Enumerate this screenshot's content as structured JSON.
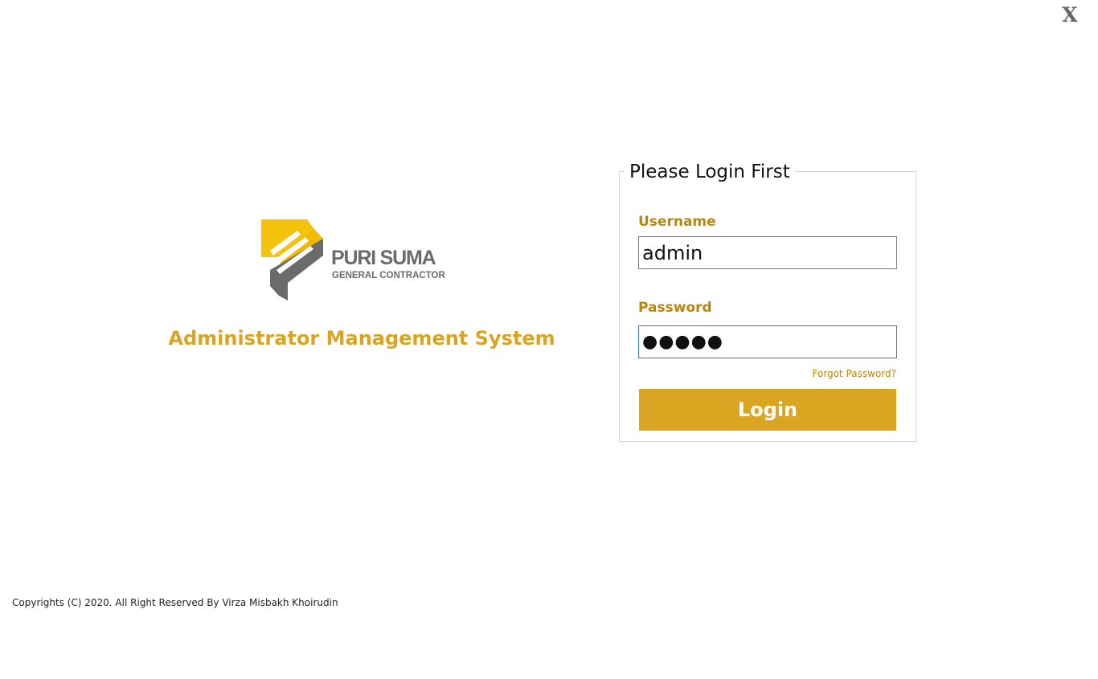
{
  "window": {
    "close_label": "X"
  },
  "brand": {
    "name": "PURI SUMA",
    "subtitle": "GENERAL CONTRACTOR",
    "app_title": "Administrator Management System",
    "colors": {
      "accent": "#daa520",
      "label": "#b8860b",
      "logo_yellow": "#f5c30c",
      "logo_gray": "#6b6b6b"
    }
  },
  "login": {
    "heading": "Please Login First",
    "username_label": "Username",
    "username_value": "admin",
    "password_label": "Password",
    "password_value": "●●●●●",
    "forgot_label": "Forgot Password?",
    "login_button": "Login"
  },
  "footer": {
    "copyright": "Copyrights (C) 2020. All Right Reserved By Virza Misbakh Khoirudin"
  },
  "icons": {
    "close": "close-icon",
    "logo": "puri-suma-logo-mark"
  }
}
